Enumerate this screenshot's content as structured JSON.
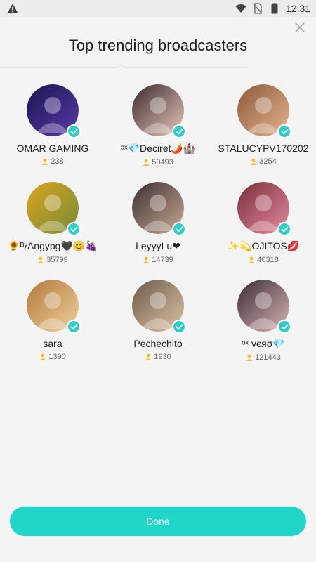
{
  "status_bar": {
    "time": "12:31",
    "icons": [
      "warning-icon",
      "wifi-icon",
      "no-sim-icon",
      "battery-icon"
    ]
  },
  "header": {
    "title": "Top trending broadcasters",
    "close_icon": "close-icon"
  },
  "broadcasters": [
    {
      "name": "OMAR GAMING",
      "count": "238",
      "avatar_colors": [
        "#1a1450",
        "#5a3aa8"
      ],
      "verified": true
    },
    {
      "name": "ᵒˣ💎Deciret🌶️🏰",
      "count": "50493",
      "avatar_colors": [
        "#3a2a2a",
        "#e9c7bd"
      ],
      "verified": true
    },
    {
      "name": "STALUCYPV170202",
      "count": "3254",
      "avatar_colors": [
        "#8e5a3a",
        "#e3b38e"
      ],
      "verified": true
    },
    {
      "name": "🌻ᴮʸAngypg🖤😊🍇",
      "count": "35799",
      "avatar_colors": [
        "#d9a41c",
        "#7a8a38"
      ],
      "verified": true
    },
    {
      "name": "LeyyyLu❤",
      "count": "14739",
      "avatar_colors": [
        "#3b2f2f",
        "#c9a996"
      ],
      "verified": true
    },
    {
      "name": "✨💫OJITOS💋",
      "count": "40318",
      "avatar_colors": [
        "#7a2e3a",
        "#e58aa0"
      ],
      "verified": true
    },
    {
      "name": "sara",
      "count": "1390",
      "avatar_colors": [
        "#b07a3a",
        "#f0cf9c"
      ],
      "verified": true
    },
    {
      "name": "Pechechito",
      "count": "1930",
      "avatar_colors": [
        "#6a5a4a",
        "#dec3a5"
      ],
      "verified": true
    },
    {
      "name": "ᵒˣ vєяσ💎",
      "count": "121443",
      "avatar_colors": [
        "#3a2c3a",
        "#d9b5b0"
      ],
      "verified": true
    }
  ],
  "footer": {
    "done_label": "Done"
  },
  "colors": {
    "accent": "#1fd6c9",
    "verified_badge": "#2dcdc8",
    "viewer_icon": "#f2c12e"
  }
}
